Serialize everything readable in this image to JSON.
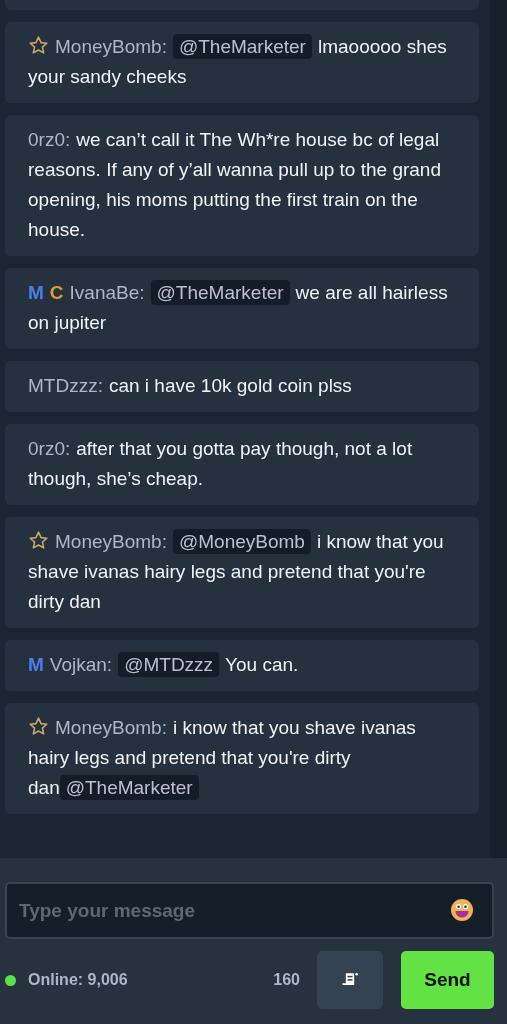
{
  "messages": [
    {
      "badges": [
        {
          "kind": "star"
        }
      ],
      "user": "MoneyBomb:",
      "parts": [
        {
          "kind": "mention",
          "text": "@TheMarketer"
        },
        {
          "kind": "text",
          "text": "lmaooooo shes your sandy cheeks"
        }
      ]
    },
    {
      "user": "0rz0:",
      "parts": [
        {
          "kind": "text",
          "text": "we can’t call it The Wh*re house bc of legal reasons. If any of y’all wanna pull up to the grand opening, his moms putting the first train on the house."
        }
      ]
    },
    {
      "badges": [
        {
          "kind": "letter",
          "text": "M",
          "color": "#4d7ee8"
        },
        {
          "kind": "letter",
          "text": "C",
          "color": "#e39a2c"
        }
      ],
      "user": "IvanaBe:",
      "parts": [
        {
          "kind": "mention",
          "text": "@TheMarketer"
        },
        {
          "kind": "text",
          "text": "we are all hairless on jupiter"
        }
      ]
    },
    {
      "user": "MTDzzz:",
      "parts": [
        {
          "kind": "text",
          "text": "can i have 10k gold coin plss"
        }
      ]
    },
    {
      "user": "0rz0:",
      "parts": [
        {
          "kind": "text",
          "text": "after that you gotta pay though, not a lot though, she’s cheap."
        }
      ]
    },
    {
      "badges": [
        {
          "kind": "star"
        }
      ],
      "user": "MoneyBomb:",
      "parts": [
        {
          "kind": "mention",
          "text": "@MoneyBomb"
        },
        {
          "kind": "text",
          "text": "i know that you shave ivanas hairy legs and pretend that you're dirty dan"
        }
      ]
    },
    {
      "badges": [
        {
          "kind": "letter",
          "text": "M",
          "color": "#4d7ee8"
        }
      ],
      "user": "Vojkan:",
      "parts": [
        {
          "kind": "mention",
          "text": "@MTDzzz"
        },
        {
          "kind": "text",
          "text": "You can."
        }
      ]
    },
    {
      "badges": [
        {
          "kind": "star"
        }
      ],
      "user": "MoneyBomb:",
      "parts": [
        {
          "kind": "text",
          "text": "i know that you shave ivanas hairy legs and pretend that you're dirty dan"
        },
        {
          "kind": "mention",
          "text": "@TheMarketer"
        }
      ]
    }
  ],
  "composer": {
    "placeholder": "Type your message"
  },
  "footer": {
    "online": "Online: 9,006",
    "char_count": "160",
    "send_label": "Send"
  }
}
